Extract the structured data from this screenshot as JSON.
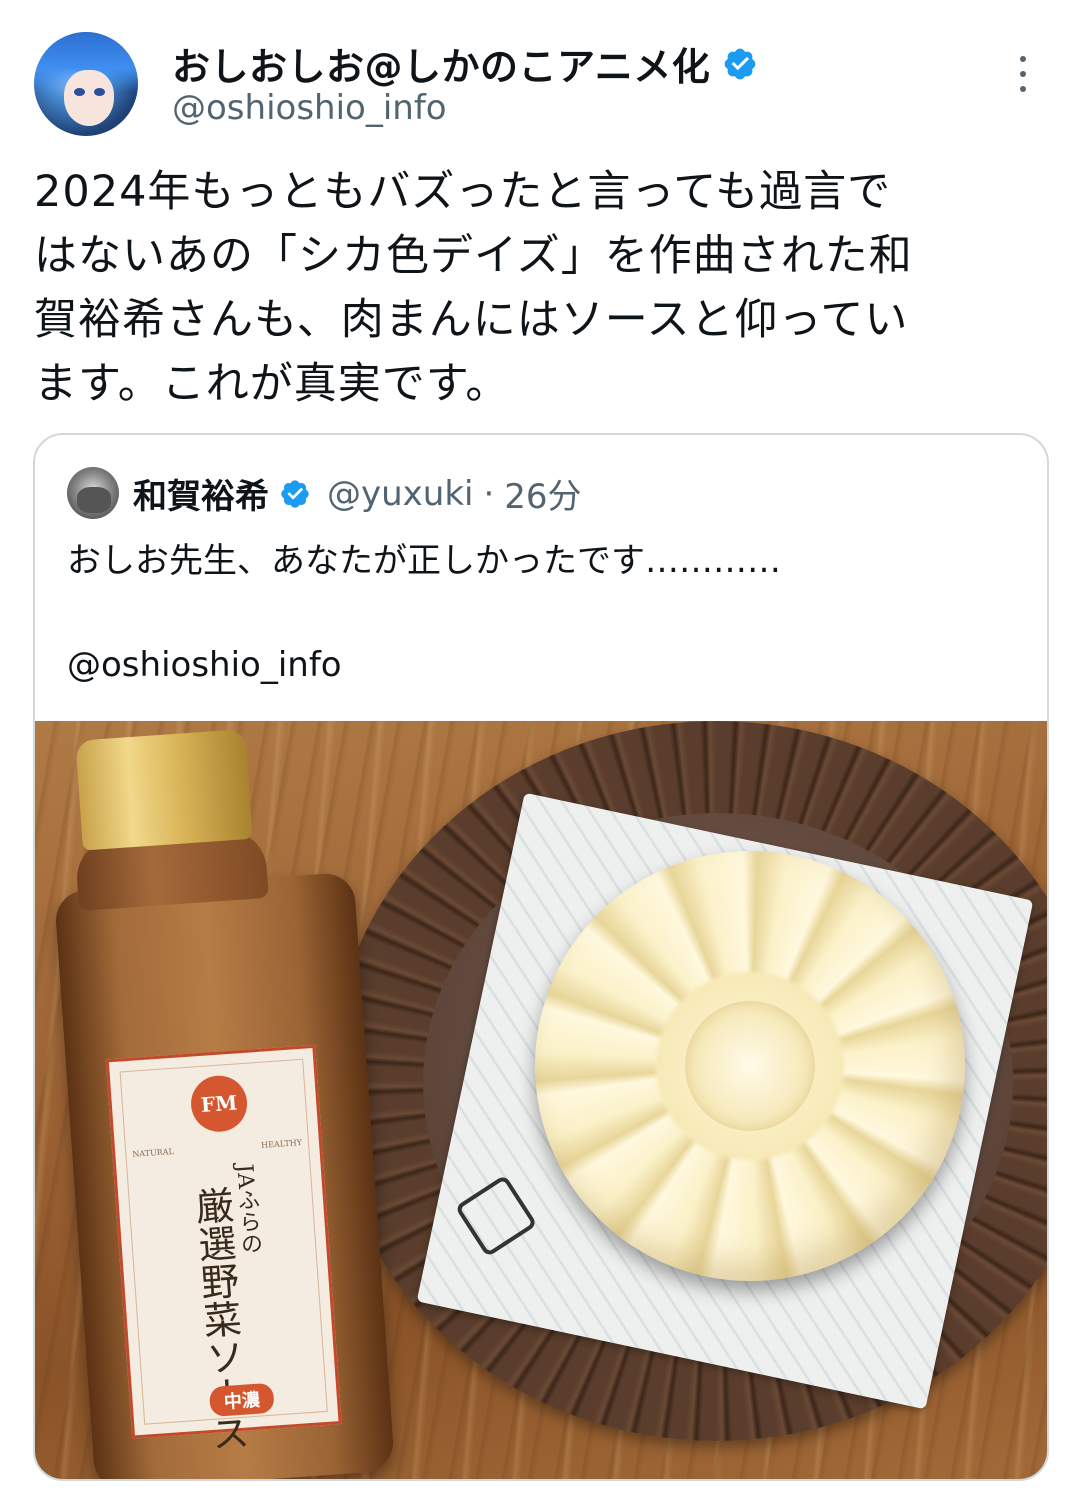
{
  "author": {
    "display_name": "おしおしお@しかのこアニメ化",
    "handle": "@oshioshio_info",
    "verified_icon": "verified-badge-icon",
    "avatar_icon": "avatar-anime-character"
  },
  "menu": {
    "icon": "more-vertical-icon"
  },
  "body": {
    "lines": [
      "2024年もっともバズったと言っても過言で",
      "はないあの「シカ色デイズ」を作曲された和",
      "賀裕希さんも、肉まんにはソースと仰ってい",
      "ます。これが真実です。"
    ]
  },
  "quote": {
    "display_name": "和賀裕希",
    "handle": "@yuxuki",
    "separator": "·",
    "time": "26分",
    "text_line1": "おしお先生、あなたが正しかったです…………",
    "text_line2": "@oshioshio_info",
    "photo": {
      "description_icon": "photo-sauce-and-nikuman",
      "label_logo": "FM",
      "label_small_left": "NATURAL",
      "label_small_right": "HEALTHY",
      "label_ja": "JAふらの",
      "label_main": "厳選野菜ソース",
      "label_badge": "中濃"
    }
  },
  "colors": {
    "text": "#0f1419",
    "secondary": "#536471",
    "verified": "#1d9bf0",
    "border": "#cfd9de"
  }
}
